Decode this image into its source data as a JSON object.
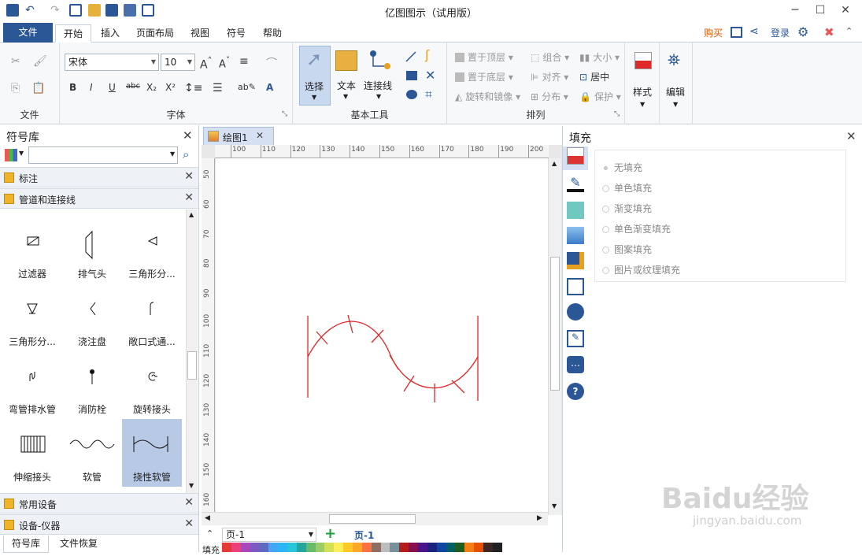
{
  "app": {
    "title": "亿图图示（试用版）"
  },
  "window": {
    "minimize": "─",
    "maximize": "☐",
    "close": "✕"
  },
  "menu": {
    "file": "文件",
    "tabs": [
      "开始",
      "插入",
      "页面布局",
      "视图",
      "符号",
      "帮助"
    ],
    "buy": "购买",
    "login": "登录"
  },
  "ribbon": {
    "file_group": "文件",
    "font_group": "字体",
    "font_name": "宋体",
    "font_size": "10",
    "basic_tools_group": "基本工具",
    "select": "选择",
    "text": "文本",
    "connector": "连接线",
    "arrange_group": "排列",
    "bring_front": "置于顶层",
    "send_back": "置于底层",
    "rotate_mirror": "旋转和镜像",
    "group": "组合",
    "align": "对齐",
    "distribute": "分布",
    "size": "大小",
    "center": "居中",
    "protect": "保护",
    "style": "样式",
    "edit": "编辑"
  },
  "library": {
    "title": "符号库",
    "search_placeholder": "",
    "sections": {
      "annotation": "标注",
      "pipes": "管道和连接线",
      "common_equipment": "常用设备",
      "equipment_instruments": "设备-仪器"
    },
    "symbols": [
      "过滤器",
      "排气头",
      "三角形分...",
      "三角形分...",
      "浇注盘",
      "敞口式通...",
      "弯管排水管",
      "消防栓",
      "旋转接头",
      "伸缩接头",
      "软管",
      "挠性软管"
    ],
    "bottom_tabs": [
      "符号库",
      "文件恢复"
    ]
  },
  "document": {
    "tab": "绘图1",
    "ruler_top": [
      "100",
      "110",
      "120",
      "130",
      "140",
      "150",
      "160",
      "170",
      "180",
      "190",
      "200"
    ],
    "ruler_left": [
      "50",
      "60",
      "70",
      "80",
      "90",
      "100",
      "110",
      "120",
      "130",
      "140",
      "150",
      "160"
    ],
    "page_selector": "页-1",
    "page_tab": "页-1",
    "fill_label": "填充"
  },
  "fill_panel": {
    "title": "填充",
    "options": [
      "无填充",
      "单色填充",
      "渐变填充",
      "单色渐变填充",
      "图案填充",
      "图片或纹理填充"
    ]
  },
  "watermark": {
    "text": "Baidu经验",
    "sub": "jingyan.baidu.com"
  },
  "colors": {
    "accent": "#2b5797",
    "curve": "#e0272a",
    "selection": "#b8c9e6",
    "buy": "#e05a00"
  }
}
